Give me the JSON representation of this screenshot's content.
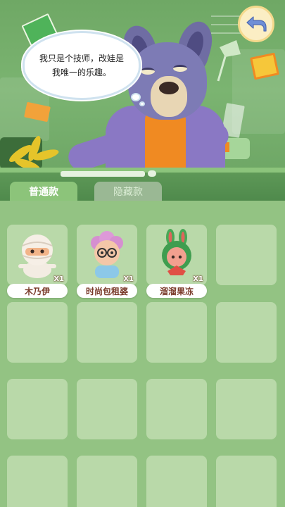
{
  "dialogue": {
    "text": "我只是个技师，改娃是我唯一的乐趣。"
  },
  "back_button": {
    "icon": "back-arrow-icon"
  },
  "tabs": [
    {
      "label": "普通款",
      "selected": true
    },
    {
      "label": "隐藏款",
      "selected": false
    }
  ],
  "collection": [
    {
      "name": "木乃伊",
      "count": "X1",
      "figure": "mummy"
    },
    {
      "name": "时尚包租婆",
      "count": "X1",
      "figure": "landlady"
    },
    {
      "name": "溜溜果冻",
      "count": "X1",
      "figure": "jelly-bunny"
    }
  ],
  "colors": {
    "accent_tab": "#8cc47a",
    "name_text": "#7a3a2a",
    "cell_bg": "#b9d9a9"
  }
}
